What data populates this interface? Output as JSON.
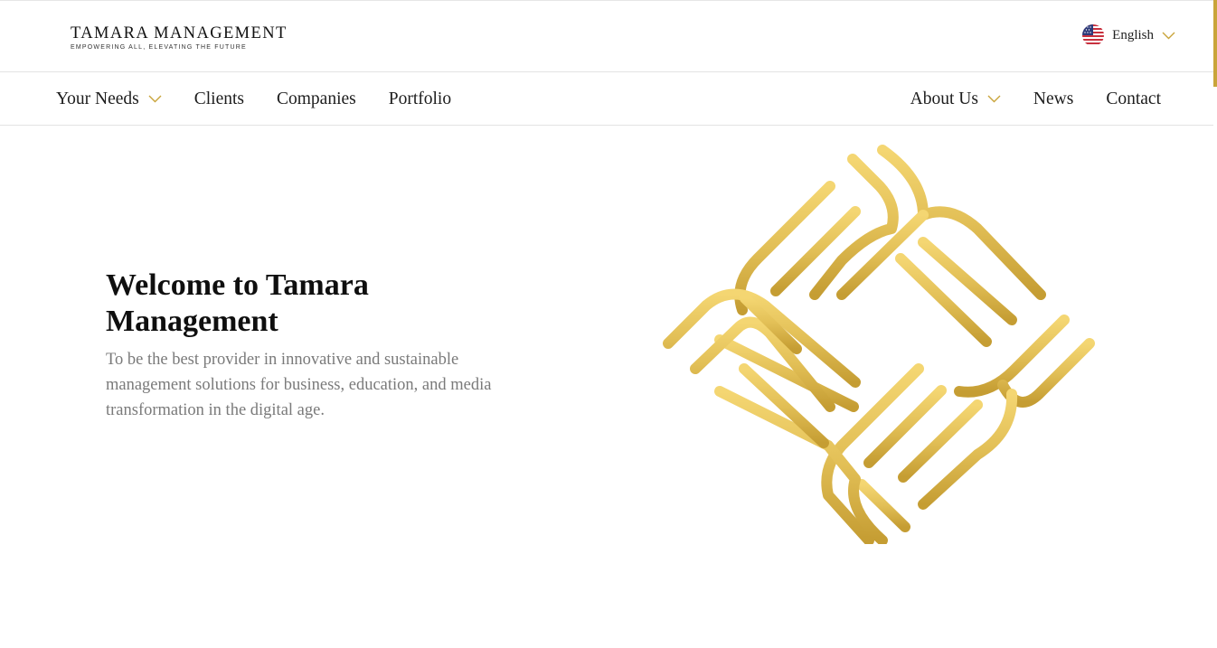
{
  "brand": {
    "name": "TAMARA MANAGEMENT",
    "tagline": "EMPOWERING ALL, ELEVATING THE FUTURE",
    "logo_icon": "interlaced-diamond-logo",
    "gold": "#d4ac41",
    "gold_light": "#f2d272",
    "gold_dark": "#c59d33"
  },
  "language": {
    "label": "English",
    "flag_icon": "us-flag-icon"
  },
  "nav": {
    "left": [
      {
        "label": "Your Needs",
        "dropdown": true
      },
      {
        "label": "Clients",
        "dropdown": false
      },
      {
        "label": "Companies",
        "dropdown": false
      },
      {
        "label": "Portfolio",
        "dropdown": false
      }
    ],
    "right": [
      {
        "label": "About Us",
        "dropdown": true
      },
      {
        "label": "News",
        "dropdown": false
      },
      {
        "label": "Contact",
        "dropdown": false
      }
    ]
  },
  "hero": {
    "title": "Welcome to Tamara Management",
    "subtitle": "To be the best provider in innovative and sustainable management solutions for business, education, and media transformation in the digital age."
  }
}
